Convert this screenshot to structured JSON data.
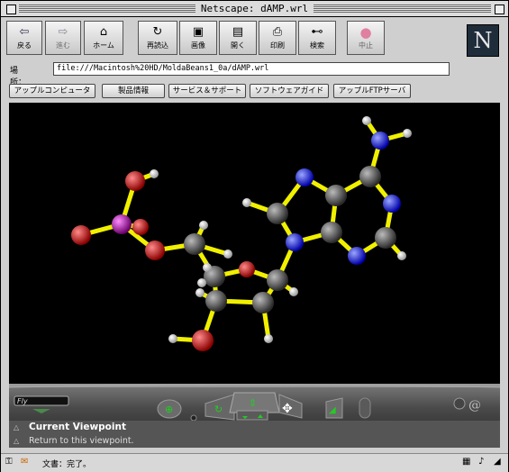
{
  "window": {
    "title": "Netscape: dAMP.wrl"
  },
  "toolbar": {
    "buttons": [
      {
        "label": "戻る",
        "icon": "back-arrow-icon",
        "glyph": "⇦"
      },
      {
        "label": "進む",
        "icon": "forward-arrow-icon",
        "glyph": "⇨"
      },
      {
        "label": "ホーム",
        "icon": "home-icon",
        "glyph": "⌂"
      },
      {
        "label": "再読込",
        "icon": "reload-icon",
        "glyph": "↻"
      },
      {
        "label": "画像",
        "icon": "images-icon",
        "glyph": "▣"
      },
      {
        "label": "開く",
        "icon": "open-icon",
        "glyph": "▤"
      },
      {
        "label": "印刷",
        "icon": "print-icon",
        "glyph": "⎙"
      },
      {
        "label": "検索",
        "icon": "search-binoculars-icon",
        "glyph": "⊷"
      },
      {
        "label": "中止",
        "icon": "stop-icon",
        "glyph": "●"
      }
    ],
    "logo": "N"
  },
  "location": {
    "label": "場所：",
    "url": "file:///Macintosh%20HD/MoldaBeans1_0a/dAMP.wrl"
  },
  "directory_buttons": [
    "アップルコンピュータ",
    "製品情報",
    "サービス＆サポート",
    "ソフトウェアガイド",
    "アップルFTPサーバ"
  ],
  "viewer": {
    "background": "#000000",
    "colors": {
      "carbon": "#555555",
      "nitrogen": "#1a1aff",
      "oxygen": "#e00000",
      "phosphorus": "#b000b0",
      "hydrogen": "#ffffff",
      "bond": "#f0f000"
    },
    "viewpoint_title": "Current Viewpoint",
    "viewpoint_sub": "Return to this viewpoint.",
    "mode_label": "Fly"
  },
  "status": {
    "text": "文書：完了。"
  }
}
